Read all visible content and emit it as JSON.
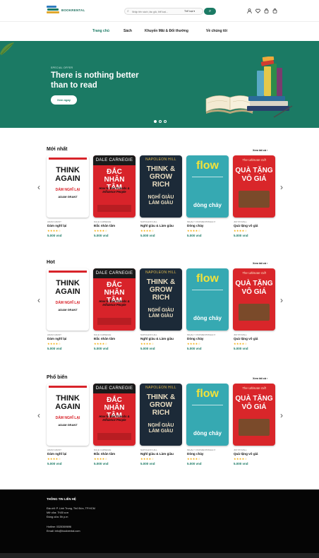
{
  "header": {
    "brand": "BOOKRENTAL",
    "search_placeholder": "Nhập tên sách, tác giả, thể loại...",
    "search_category": "Thể loại"
  },
  "nav": [
    "Trang chủ",
    "Sách",
    "Khuyến Mãi & Đổi thưởng",
    "Về chúng tôi"
  ],
  "hero": {
    "kicker": "SPECIAL OFFER",
    "title": "There is nothing better than to read",
    "cta": "Xem ngay",
    "slide_count": 3,
    "active_slide": 0
  },
  "sections": [
    {
      "title": "Mới nhất",
      "see_all": "Xem tất cả"
    },
    {
      "title": "Hot",
      "see_all": "Xem tất cả"
    },
    {
      "title": "Phổ biến",
      "see_all": "Xem tất cả"
    }
  ],
  "books": [
    {
      "author": "ADAM GRANT",
      "name": "Dám nghĩ lại",
      "stars": 4,
      "price": "5.000 vnd",
      "cover": {
        "top": "THINK",
        "mid": "AGAIN",
        "vn": "DÁM NGHĨ LẠI",
        "by": "ADAM GRANT"
      }
    },
    {
      "author": "DALE CARNEGIE",
      "name": "Đắc nhân tâm",
      "stars": 4,
      "price": "5.000 vnd",
      "cover": {
        "top": "DALE CARNEGIE",
        "mid": "ĐẮC NHÂN TÂM",
        "vn": "How to Win Friends & Influence People",
        "by": ""
      }
    },
    {
      "author": "NAPOLEON HILL",
      "name": "Nghĩ giàu & Làm giàu",
      "stars": 4,
      "price": "5.000 vnd",
      "cover": {
        "top": "NAPOLEON HILL",
        "mid": "THINK & GROW RICH",
        "vn": "NGHĨ GIÀU LÀM GIÀU",
        "by": ""
      }
    },
    {
      "author": "MIHALY CSIKSZENTMIHALYI",
      "name": "Dòng chảy",
      "stars": 4,
      "price": "5.000 vnd",
      "cover": {
        "top": "flow",
        "mid": "",
        "vn": "dòng chảy",
        "by": ""
      }
    },
    {
      "author": "JIM STOVALL",
      "name": "Quà tặng vô giá",
      "stars": 4,
      "price": "5.000 vnd",
      "cover": {
        "top": "The Ultimate Gift",
        "mid": "QUÀ TẶNG",
        "vn": "VÔ GIÁ",
        "by": ""
      }
    }
  ],
  "footer": {
    "title": "THÔNG TIN LIÊN HỆ",
    "address": "Địa chỉ: P. Linh Trung, Thủ Đức, TP.HCM",
    "open": "Mở cửa: 7h30 a.m",
    "close": "Đóng cửa: 5h p.m",
    "hotline": "Hotline: 0328369696",
    "email": "Email: info@bookrental.com"
  },
  "colors": {
    "brand": "#1b7a64",
    "star": "#f2a900"
  }
}
